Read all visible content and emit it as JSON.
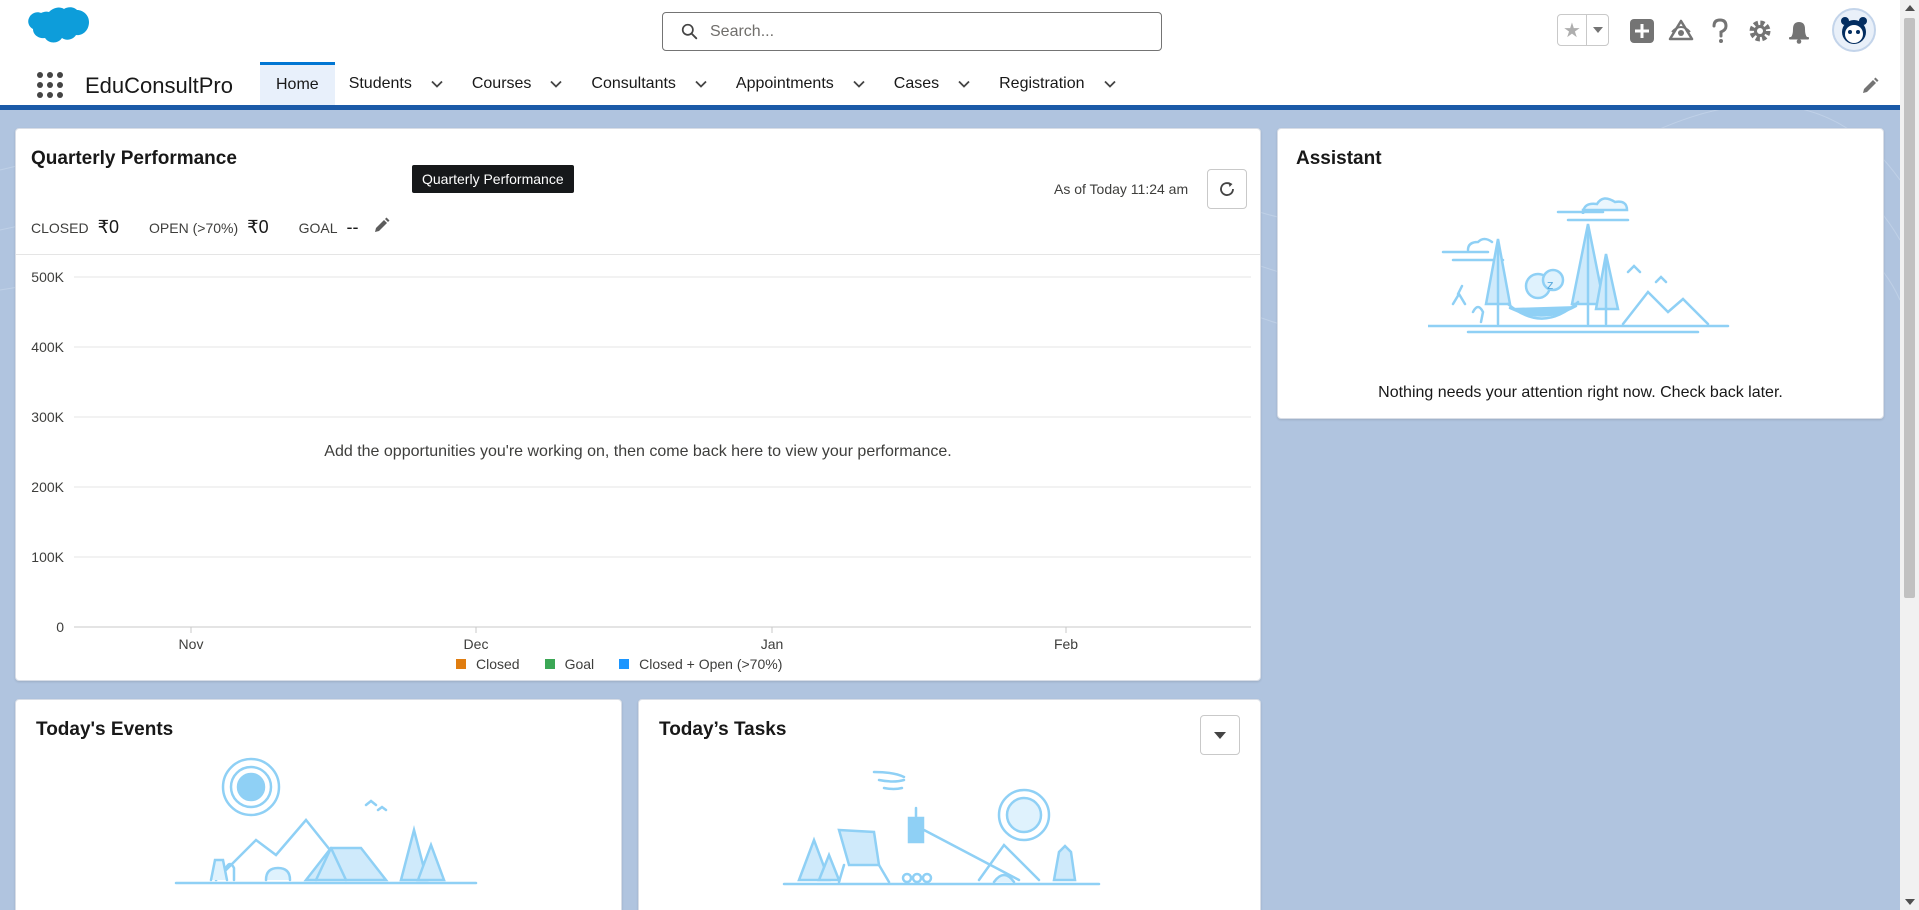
{
  "header": {
    "search_placeholder": "Search..."
  },
  "nav": {
    "app_name": "EduConsultPro",
    "tabs": [
      {
        "label": "Home",
        "active": true
      },
      {
        "label": "Students"
      },
      {
        "label": "Courses"
      },
      {
        "label": "Consultants"
      },
      {
        "label": "Appointments"
      },
      {
        "label": "Cases"
      },
      {
        "label": "Registration"
      }
    ]
  },
  "quarterly": {
    "title": "Quarterly Performance",
    "tooltip": "Quarterly Performance",
    "as_of": "As of Today 11:24 am",
    "closed_label": "CLOSED",
    "closed_value": "₹0",
    "open_label": "OPEN (>70%)",
    "open_value": "₹0",
    "goal_label": "GOAL",
    "goal_value": "--",
    "empty_message": "Add the opportunities you're working on, then come back here to view your performance."
  },
  "chart_data": {
    "type": "line",
    "categories": [
      "Nov",
      "Dec",
      "Jan",
      "Feb"
    ],
    "y_ticks": [
      "500K",
      "400K",
      "300K",
      "200K",
      "100K",
      "0"
    ],
    "ylim": [
      0,
      500000
    ],
    "series": [
      {
        "name": "Closed",
        "values": [],
        "color": "#e07d10"
      },
      {
        "name": "Goal",
        "values": [],
        "color": "#3ba755"
      },
      {
        "name": "Closed + Open (>70%)",
        "values": [],
        "color": "#1b96ff"
      }
    ],
    "grid": true,
    "legend": "bottom-center"
  },
  "assistant": {
    "title": "Assistant",
    "message": "Nothing needs your attention right now. Check back later."
  },
  "events": {
    "title": "Today's Events"
  },
  "tasks": {
    "title": "Today’s Tasks"
  },
  "colors": {
    "brand_blue": "#1b5aa8",
    "accent": "#0176d3",
    "illustration": "#8fd0f5"
  }
}
